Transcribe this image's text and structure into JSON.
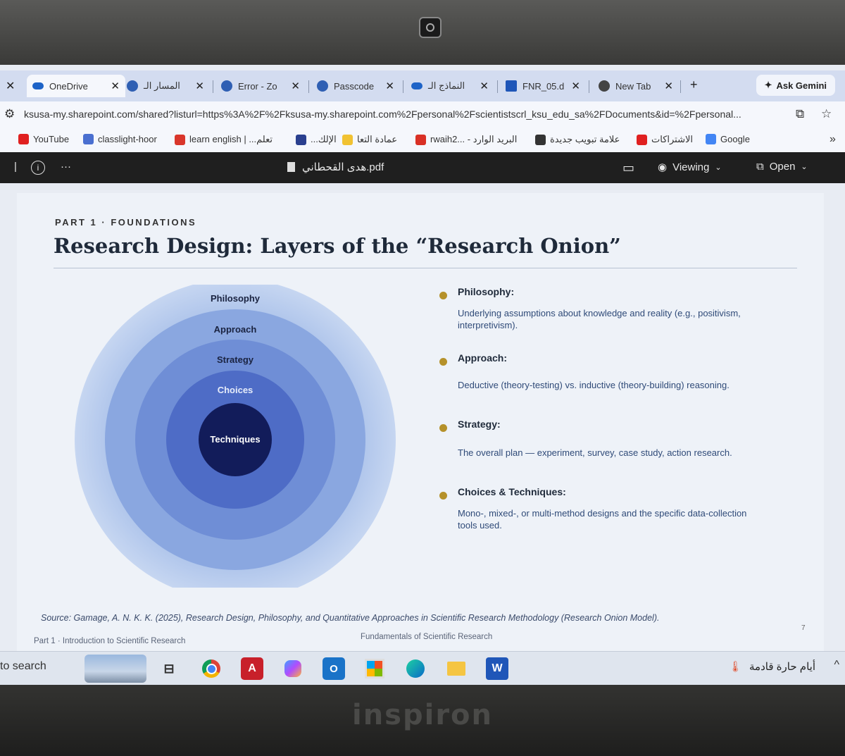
{
  "browser": {
    "tabs": [
      {
        "label": "OneDrive",
        "active": true
      },
      {
        "label": "المسار الـ"
      },
      {
        "label": "Error - Zo"
      },
      {
        "label": "Passcode"
      },
      {
        "label": "النماذج الـ"
      },
      {
        "label": "FNR_05.d"
      },
      {
        "label": "New Tab"
      }
    ],
    "new_tab": "+",
    "ask_gemini": "Ask Gemini",
    "url": "ksusa-my.sharepoint.com/shared?listurl=https%3A%2F%2Fksusa-my.sharepoint.com%2Fpersonal%2Fscientistscrl_ksu_edu_sa%2FDocuments&id=%2Fpersonal...",
    "bookmarks": [
      {
        "label": "YouTube",
        "color": "#e02020"
      },
      {
        "label": "classlight-hoor",
        "color": "#4a6fd0"
      },
      {
        "label": "learn english | ...تعلم",
        "color": "#d9362b"
      },
      {
        "label": "...الإلك",
        "color": "#2a3f8f"
      },
      {
        "label": "عمادة التعا",
        "color": "#f1c232"
      },
      {
        "label": "rwaih2... - البريد الوارد",
        "color": "#d93025"
      },
      {
        "label": "علامة تبويب جديدة",
        "color": "#333333"
      },
      {
        "label": "الاشتراكات",
        "color": "#e02020"
      },
      {
        "label": "Google",
        "color": "#4285f4"
      }
    ],
    "bookmarks_more": "»"
  },
  "viewer": {
    "file_name": "هدى القحطاني.pdf",
    "viewing": "Viewing",
    "open": "Open",
    "more": "···"
  },
  "slide": {
    "kicker": "PART 1 · FOUNDATIONS",
    "title": "Research Design: Layers of the “Research Onion”",
    "onion_layers": [
      "Philosophy",
      "Approach",
      "Strategy",
      "Choices",
      "Techniques"
    ],
    "bullets": [
      {
        "heading": "Philosophy:",
        "text": "Underlying assumptions about knowledge and reality (e.g., positivism, interpretivism)."
      },
      {
        "heading": "Approach:",
        "text": "Deductive (theory-testing) vs. inductive (theory-building) reasoning."
      },
      {
        "heading": "Strategy:",
        "text": "The overall plan — experiment, survey, case study, action research."
      },
      {
        "heading": "Choices & Techniques:",
        "text": "Mono-, mixed-, or multi-method designs and the specific data-collection tools used."
      }
    ],
    "source": "Source: Gamage, A. N. K. K. (2025), Research Design, Philosophy, and Quantitative Approaches in Scientific Research Methodology (Research Onion Model).",
    "footer_left": "Part 1 · Introduction to Scientific Research",
    "footer_center": "Fundamentals of Scientific Research",
    "page_number": "7"
  },
  "taskbar": {
    "search": "to search",
    "weather": "أيام حارة قادمة",
    "tray_up": "^"
  },
  "laptop_brand": "inspiron"
}
